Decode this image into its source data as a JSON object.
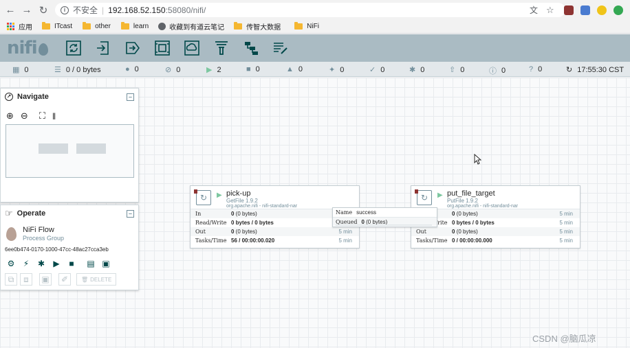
{
  "browser": {
    "secure_label": "不安全",
    "url_host": "192.168.52.150",
    "url_path": ":58080/nifi/",
    "bookmarks": [
      {
        "label": "应用"
      },
      {
        "label": "ITcast"
      },
      {
        "label": "other"
      },
      {
        "label": "learn"
      },
      {
        "label": "收藏到有道云笔记"
      },
      {
        "label": "传智大数据"
      },
      {
        "label": "NiFi"
      }
    ]
  },
  "nifi": {
    "logo": "nifi",
    "status": {
      "active_threads": "0",
      "queued": "0 / 0 bytes",
      "transmitting": "0",
      "not_transmitting": "0",
      "running": "2",
      "stopped": "0",
      "invalid": "0",
      "disabled": "0",
      "up_to_date": "0",
      "locally_modified": "0",
      "stale": "0",
      "modified_stale": "0",
      "sync_failure": "0",
      "refreshed": "17:55:30 CST"
    },
    "navigate": {
      "title": "Navigate"
    },
    "operate": {
      "title": "Operate",
      "name": "NiFi Flow",
      "type": "Process Group",
      "id": "6ee0b474-0170-1000-47cc-48ac27cca3eb",
      "delete_label": "DELETE"
    },
    "processors": [
      {
        "name": "pick-up",
        "type": "GetFile 1.9.2",
        "bundle": "org.apache.nifi - nifi-standard-nar",
        "rows": [
          {
            "label": "In",
            "bold": "0",
            "rest": " (0 bytes)",
            "time": ""
          },
          {
            "label": "Read/Write",
            "bold": "0 bytes / 0 bytes",
            "rest": "",
            "time": ""
          },
          {
            "label": "Out",
            "bold": "0",
            "rest": " (0 bytes)",
            "time": "5 min"
          },
          {
            "label": "Tasks/Time",
            "bold": "56 / 00:00:00.020",
            "rest": "",
            "time": "5 min"
          }
        ]
      },
      {
        "name": "put_file_target",
        "type": "PutFile 1.9.2",
        "bundle": "org.apache.nifi - nifi-standard-nar",
        "rows": [
          {
            "label": "",
            "bold": "0",
            "rest": " (0 bytes)",
            "time": "5 min"
          },
          {
            "label": "Read/Write",
            "bold": "0 bytes / 0 bytes",
            "rest": "",
            "time": "5 min"
          },
          {
            "label": "Out",
            "bold": "0",
            "rest": " (0 bytes)",
            "time": "5 min"
          },
          {
            "label": "Tasks/Time",
            "bold": "0 / 00:00:00.000",
            "rest": "",
            "time": "5 min"
          }
        ]
      }
    ],
    "connection": {
      "name_label": "Name",
      "name_value": "success",
      "queued_label": "Queued",
      "queued_bold": "0",
      "queued_rest": " (0 bytes)"
    }
  },
  "watermark": "CSDN @脑瓜凉",
  "colors": {
    "header": "#aabbc3",
    "accent": "#728e9b",
    "running": "#7dc7a0",
    "invalid_flag": "#8e3432"
  }
}
